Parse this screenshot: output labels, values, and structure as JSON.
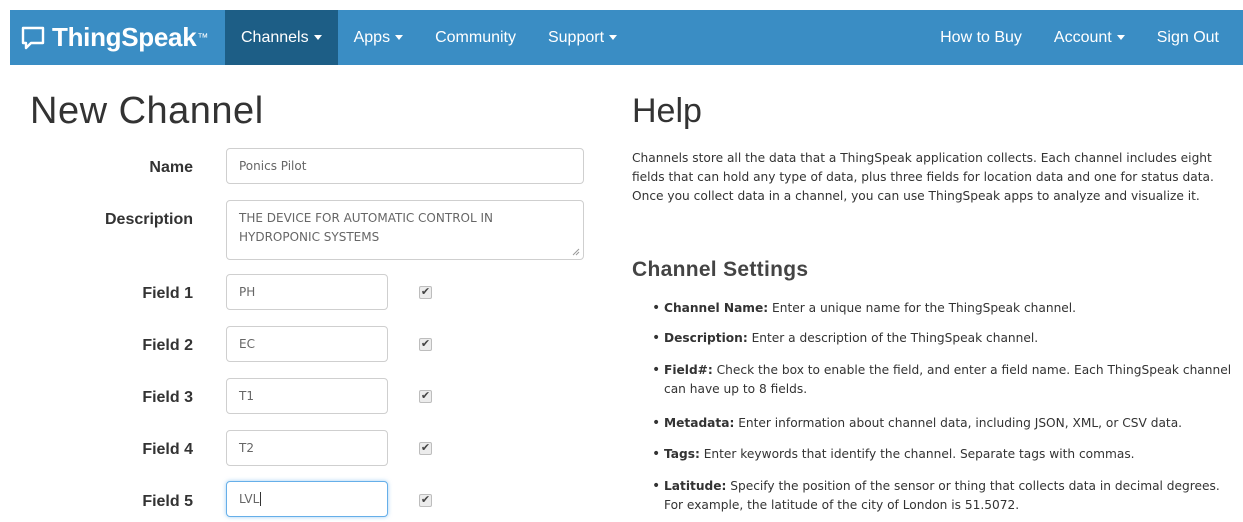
{
  "nav": {
    "brand": "ThingSpeak",
    "brand_tm": "™",
    "left_items": [
      {
        "label": "Channels",
        "dropdown": true,
        "active": true
      },
      {
        "label": "Apps",
        "dropdown": true,
        "active": false
      },
      {
        "label": "Community",
        "dropdown": false,
        "active": false
      },
      {
        "label": "Support",
        "dropdown": true,
        "active": false
      }
    ],
    "right_items": [
      {
        "label": "How to Buy",
        "dropdown": false
      },
      {
        "label": "Account",
        "dropdown": true
      },
      {
        "label": "Sign Out",
        "dropdown": false
      }
    ],
    "colors": {
      "bar": "#3a8dc4",
      "active": "#1d5e86"
    }
  },
  "form": {
    "title": "New Channel",
    "name_label": "Name",
    "name_value": "Ponics Pilot",
    "description_label": "Description",
    "description_value": "THE DEVICE FOR AUTOMATIC CONTROL IN HYDROPONIC SYSTEMS",
    "fields": [
      {
        "label": "Field 1",
        "value": "PH",
        "checked": true,
        "focused": false
      },
      {
        "label": "Field 2",
        "value": "EC",
        "checked": true,
        "focused": false
      },
      {
        "label": "Field 3",
        "value": "T1",
        "checked": true,
        "focused": false
      },
      {
        "label": "Field 4",
        "value": "T2",
        "checked": true,
        "focused": false
      },
      {
        "label": "Field 5",
        "value": "LVL",
        "checked": true,
        "focused": true
      }
    ]
  },
  "help": {
    "title": "Help",
    "intro": "Channels store all the data that a ThingSpeak application collects. Each channel includes eight fields that can hold any type of data, plus three fields for location data and one for status data. Once you collect data in a channel, you can use ThingSpeak apps to analyze and visualize it.",
    "settings_title": "Channel Settings",
    "items": [
      {
        "term": "Channel Name:",
        "text": " Enter a unique name for the ThingSpeak channel."
      },
      {
        "term": "Description:",
        "text": " Enter a description of the ThingSpeak channel."
      },
      {
        "term": "Field#:",
        "text": " Check the box to enable the field, and enter a field name. Each ThingSpeak channel can have up to 8 fields."
      },
      {
        "term": "Metadata:",
        "text": " Enter information about channel data, including JSON, XML, or CSV data."
      },
      {
        "term": "Tags:",
        "text": " Enter keywords that identify the channel. Separate tags with commas."
      },
      {
        "term": "Latitude:",
        "text": " Specify the position of the sensor or thing that collects data in decimal degrees. For example, the latitude of the city of London is 51.5072."
      }
    ]
  }
}
